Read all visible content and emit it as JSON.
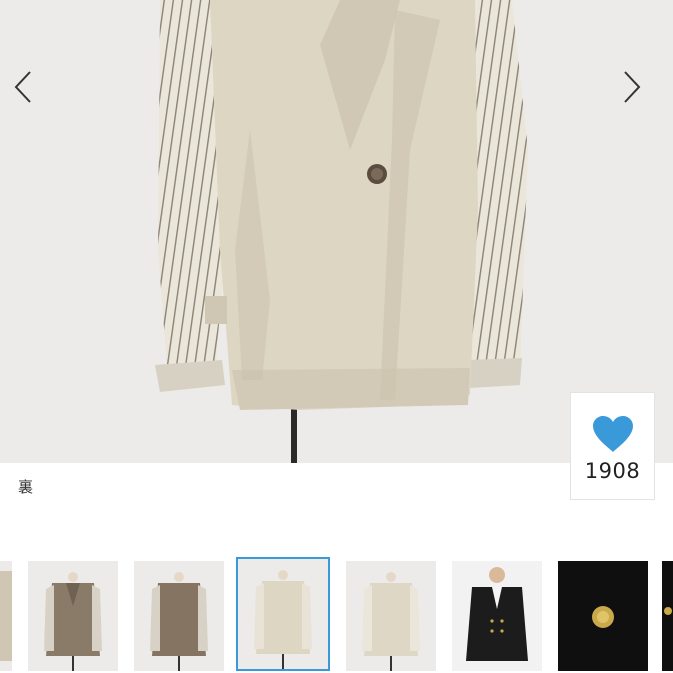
{
  "gallery": {
    "prev_icon": "chevron-left-icon",
    "next_icon": "chevron-right-icon",
    "image_caption": "裏"
  },
  "like": {
    "icon": "heart-icon",
    "count": "1908",
    "color": "#3a9ad9"
  },
  "thumbnails": {
    "selected_index": 3,
    "accent_color": "#3a9ad9",
    "items": [
      {
        "kind": "partial"
      },
      {
        "kind": "brown-jacket"
      },
      {
        "kind": "brown-jacket-back"
      },
      {
        "kind": "beige-jacket"
      },
      {
        "kind": "beige-jacket-back"
      },
      {
        "kind": "black-jacket-model"
      },
      {
        "kind": "black-fabric-button"
      },
      {
        "kind": "partial-black"
      }
    ]
  }
}
